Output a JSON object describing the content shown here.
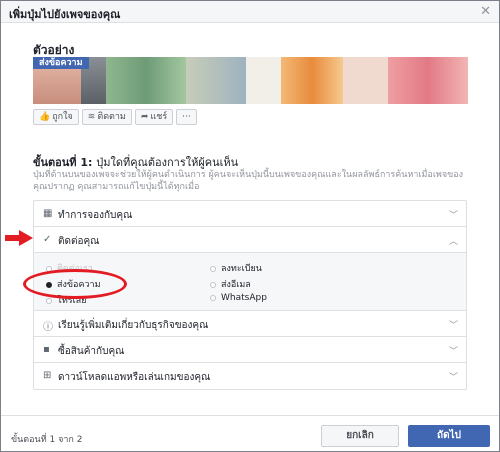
{
  "dialog": {
    "title": "เพิ่มปุ่มไปยังเพจของคุณ",
    "close_icon": "close-icon"
  },
  "preview": {
    "title": "ตัวอย่าง",
    "cta_label": "ส่งข้อความ",
    "actions": [
      {
        "label": "ถูกใจ",
        "icon": "thumbs-up-icon",
        "glyph": "👍"
      },
      {
        "label": "ติดตาม",
        "icon": "rss-icon",
        "glyph": "≋"
      },
      {
        "label": "แชร์",
        "icon": "share-icon",
        "glyph": "➦"
      },
      {
        "label": "···",
        "icon": "more-icon",
        "glyph": ""
      }
    ]
  },
  "step": {
    "title_prefix": "ขั้นตอนที่ 1:",
    "title_question": "ปุ่มใดที่คุณต้องการให้ผู้คนเห็น",
    "description": "ปุ่มที่ด้านบนของเพจจะช่วยให้ผู้คนดำเนินการ ผู้คนจะเห็นปุ่มนี้บนเพจของคุณและในผลลัพธ์การค้นหาเมื่อเพจของคุณปรากฏ คุณสามารถแก้ไขปุ่มนี้ได้ทุกเมื่อ"
  },
  "options": [
    {
      "label": "ทำการจองกับคุณ",
      "icon": "calendar-icon",
      "glyph": "▦",
      "expanded": false
    },
    {
      "label": "ติดต่อคุณ",
      "icon": "checkmark-icon",
      "glyph": "✓",
      "expanded": true
    },
    {
      "label": "เรียนรู้เพิ่มเติมเกี่ยวกับธุรกิจของคุณ",
      "icon": "info-icon",
      "glyph": "ⓘ",
      "expanded": false
    },
    {
      "label": "ซื้อสินค้ากับคุณ",
      "icon": "bag-icon",
      "glyph": "▪",
      "expanded": false
    },
    {
      "label": "ดาวน์โหลดแอพหรือเล่นเกมของคุณ",
      "icon": "download-icon",
      "glyph": "⊞",
      "expanded": false
    }
  ],
  "contact_choices": {
    "left": [
      {
        "label": "ติดต่อเรา",
        "selected": false
      },
      {
        "label": "ส่งข้อความ",
        "selected": true
      },
      {
        "label": "โทรเลย",
        "selected": false
      }
    ],
    "right": [
      {
        "label": "ลงทะเบียน",
        "selected": false
      },
      {
        "label": "ส่งอีเมล",
        "selected": false
      },
      {
        "label": "WhatsApp",
        "selected": false
      }
    ]
  },
  "footer": {
    "step_count": "ขั้นตอนที่ 1 จาก 2",
    "cancel_label": "ยกเลิก",
    "next_label": "ถัดไป"
  },
  "colors": {
    "brand": "#4267b2",
    "annotation": "#e31b23"
  }
}
